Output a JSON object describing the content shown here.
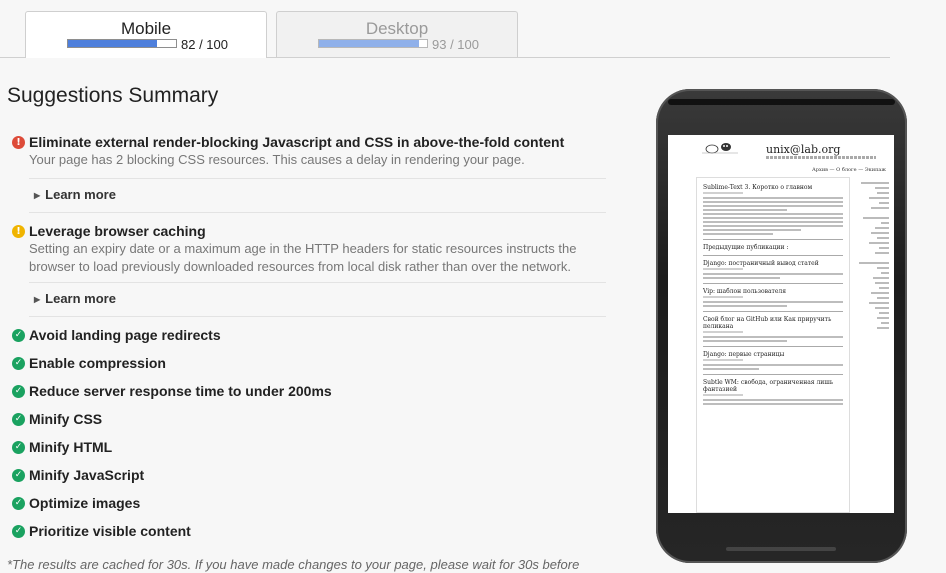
{
  "tabs": {
    "mobile": {
      "label": "Mobile",
      "score_text": "82 / 100",
      "score": 82
    },
    "desktop": {
      "label": "Desktop",
      "score_text": "93 / 100",
      "score": 93
    }
  },
  "summary_title": "Suggestions Summary",
  "should_fix": [
    {
      "title": "Eliminate external render-blocking Javascript and CSS in above-the-fold content",
      "description": "Your page has 2 blocking CSS resources. This causes a delay in rendering your page.",
      "learn_more": "Learn more",
      "status_icon": "error-icon",
      "color": "#dd4b39"
    },
    {
      "title": "Leverage browser caching",
      "description": "Setting an expiry date or a maximum age in the HTTP headers for static resources instructs the browser to load previously downloaded resources from local disk rather than over the network.",
      "learn_more": "Learn more",
      "status_icon": "warning-icon",
      "color": "#f0b400"
    }
  ],
  "passed": [
    "Avoid landing page redirects",
    "Enable compression",
    "Reduce server response time to under 200ms",
    "Minify CSS",
    "Minify HTML",
    "Minify JavaScript",
    "Optimize images",
    "Prioritize visible content"
  ],
  "passed_icon": "check-icon",
  "passed_color": "#1aa260",
  "footnote": "*The results are cached for 30s. If you have made changes to your page, please wait for 30s before",
  "preview": {
    "site_name": "unix@lab.org",
    "nav": "Архив — О блоге — Экипаж",
    "post_titles": [
      "Sublime-Text 3. Коротко о главном",
      "Предыдущие публикации :",
      "Django: постраничный вывод статей",
      "Vip: шаблон пользователя",
      "Свой блог на GitHub или Как приручить пеликана",
      "Django: первые страницы",
      "Subtle WM: свобода, ограниченная лишь фантазией"
    ]
  }
}
